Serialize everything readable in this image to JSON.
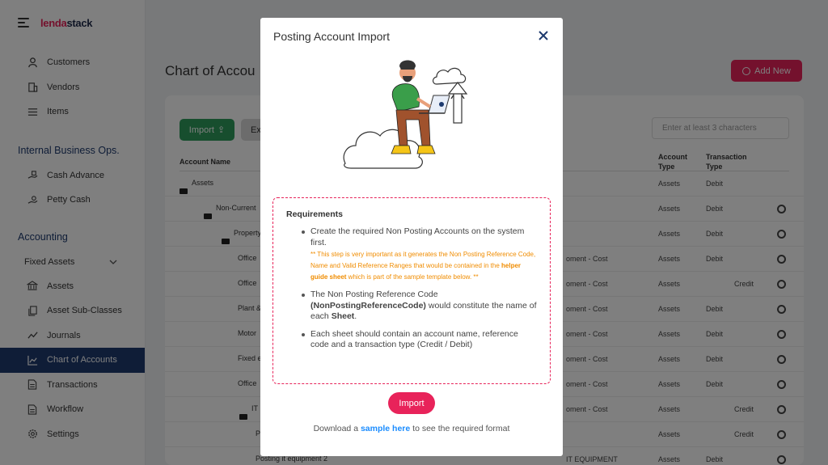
{
  "brand": {
    "name_a": "lenda",
    "name_b": "stack"
  },
  "sidebar": {
    "top_items": [
      {
        "label": "Customers",
        "icon": "user-icon"
      },
      {
        "label": "Vendors",
        "icon": "building-icon"
      },
      {
        "label": "Items",
        "icon": "list-icon"
      }
    ],
    "section_internal": "Internal Business Ops.",
    "internal_items": [
      {
        "label": "Cash Advance",
        "icon": "hand-cash-icon"
      },
      {
        "label": "Petty Cash",
        "icon": "hand-coin-icon"
      }
    ],
    "section_accounting": "Accounting",
    "fixed_assets": "Fixed Assets",
    "accounting_items": [
      {
        "label": "Assets",
        "icon": "bank-icon"
      },
      {
        "label": "Asset Sub-Classes",
        "icon": "copy-icon"
      },
      {
        "label": "Journals",
        "icon": "trend-icon"
      },
      {
        "label": "Chart of Accounts",
        "icon": "chart-icon"
      },
      {
        "label": "Transactions",
        "icon": "document-icon"
      },
      {
        "label": "Workflow",
        "icon": "document-icon"
      },
      {
        "label": "Settings",
        "icon": "gear-icon"
      }
    ]
  },
  "page": {
    "title": "Chart of Accou",
    "add_new": "Add New",
    "import_label": "Import",
    "export_label": "Ex",
    "search_placeholder": "Enter at least 3 characters",
    "col_account_name": "Account Name",
    "col_account_type_1": "Account",
    "col_account_type_2": "Type",
    "col_txn_type_1": "Transaction",
    "col_txn_type_2": "Type",
    "rows": [
      {
        "name": "Assets",
        "sub": "",
        "type": "Assets",
        "debit": "Debit",
        "credit": "",
        "gear": false
      },
      {
        "name": "Non-Current",
        "sub": "",
        "type": "Assets",
        "debit": "Debit",
        "credit": "",
        "gear": true
      },
      {
        "name": "Property",
        "sub": "",
        "type": "Assets",
        "debit": "Debit",
        "credit": "",
        "gear": true
      },
      {
        "name": "Office",
        "sub": "oment - Cost",
        "type": "Assets",
        "debit": "Debit",
        "credit": "",
        "gear": true
      },
      {
        "name": "Office",
        "sub": "oment - Cost",
        "type": "Assets",
        "debit": "",
        "credit": "Credit",
        "gear": true
      },
      {
        "name": "Plant &",
        "sub": "oment - Cost",
        "type": "Assets",
        "debit": "Debit",
        "credit": "",
        "gear": true
      },
      {
        "name": "Motor",
        "sub": "oment - Cost",
        "type": "Assets",
        "debit": "Debit",
        "credit": "",
        "gear": true
      },
      {
        "name": "Fixed e",
        "sub": "oment - Cost",
        "type": "Assets",
        "debit": "Debit",
        "credit": "",
        "gear": true
      },
      {
        "name": "Office",
        "sub": "oment - Cost",
        "type": "Assets",
        "debit": "Debit",
        "credit": "",
        "gear": true
      },
      {
        "name": "IT",
        "sub": "oment - Cost",
        "type": "Assets",
        "debit": "",
        "credit": "Credit",
        "gear": true
      },
      {
        "name": "P",
        "sub": "",
        "type": "Assets",
        "debit": "",
        "credit": "Credit",
        "gear": true
      },
      {
        "name": "Posting it equipment 2",
        "sub": "IT EQUIPMENT",
        "type": "Assets",
        "debit": "Debit",
        "credit": "",
        "gear": true
      }
    ]
  },
  "modal": {
    "title": "Posting Account Import",
    "requirements_title": "Requirements",
    "req1": "Create the required Non Posting Accounts on the system first.",
    "warn_a": "** This step is very important as it generates the Non Posting Reference Code, Name and Valid Reference Ranges that would be contained in the ",
    "warn_bold": "helper guide sheet",
    "warn_b": " which is part of the sample template below. **",
    "req2_a": "The Non Posting Reference Code ",
    "req2_bold": "(NonPostingReferenceCode)",
    "req2_b": " would constitute the name of each ",
    "req2_bold2": "Sheet",
    "req2_c": ".",
    "req3": "Each sheet should contain an account name, reference code and a transaction type (Credit / Debit)",
    "import_button": "Import",
    "download_a": "Download a ",
    "download_link": "sample here",
    "download_b": " to see the required format"
  }
}
